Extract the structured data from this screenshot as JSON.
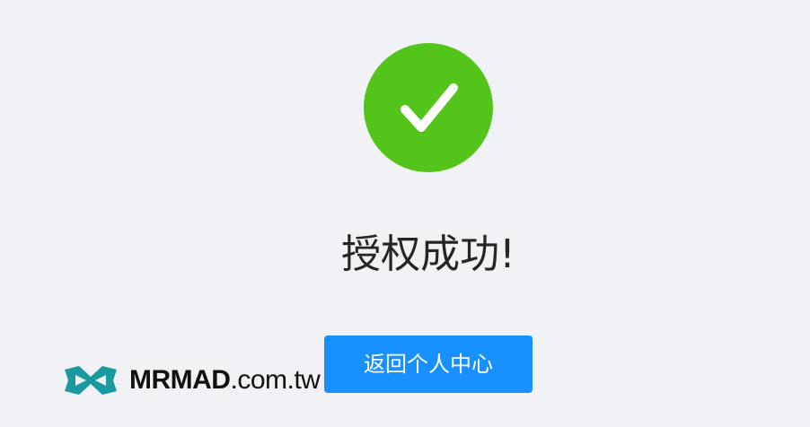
{
  "result": {
    "title": "授权成功!",
    "button_label": "返回个人中心"
  },
  "colors": {
    "success": "#52c41a",
    "primary": "#1890ff",
    "background": "#f0f2f5"
  },
  "watermark": {
    "brand": "MRMAD",
    "domain": ".com.tw",
    "logo_icon": "infinity-ribbon-icon",
    "logo_color": "#1a9aa0"
  }
}
